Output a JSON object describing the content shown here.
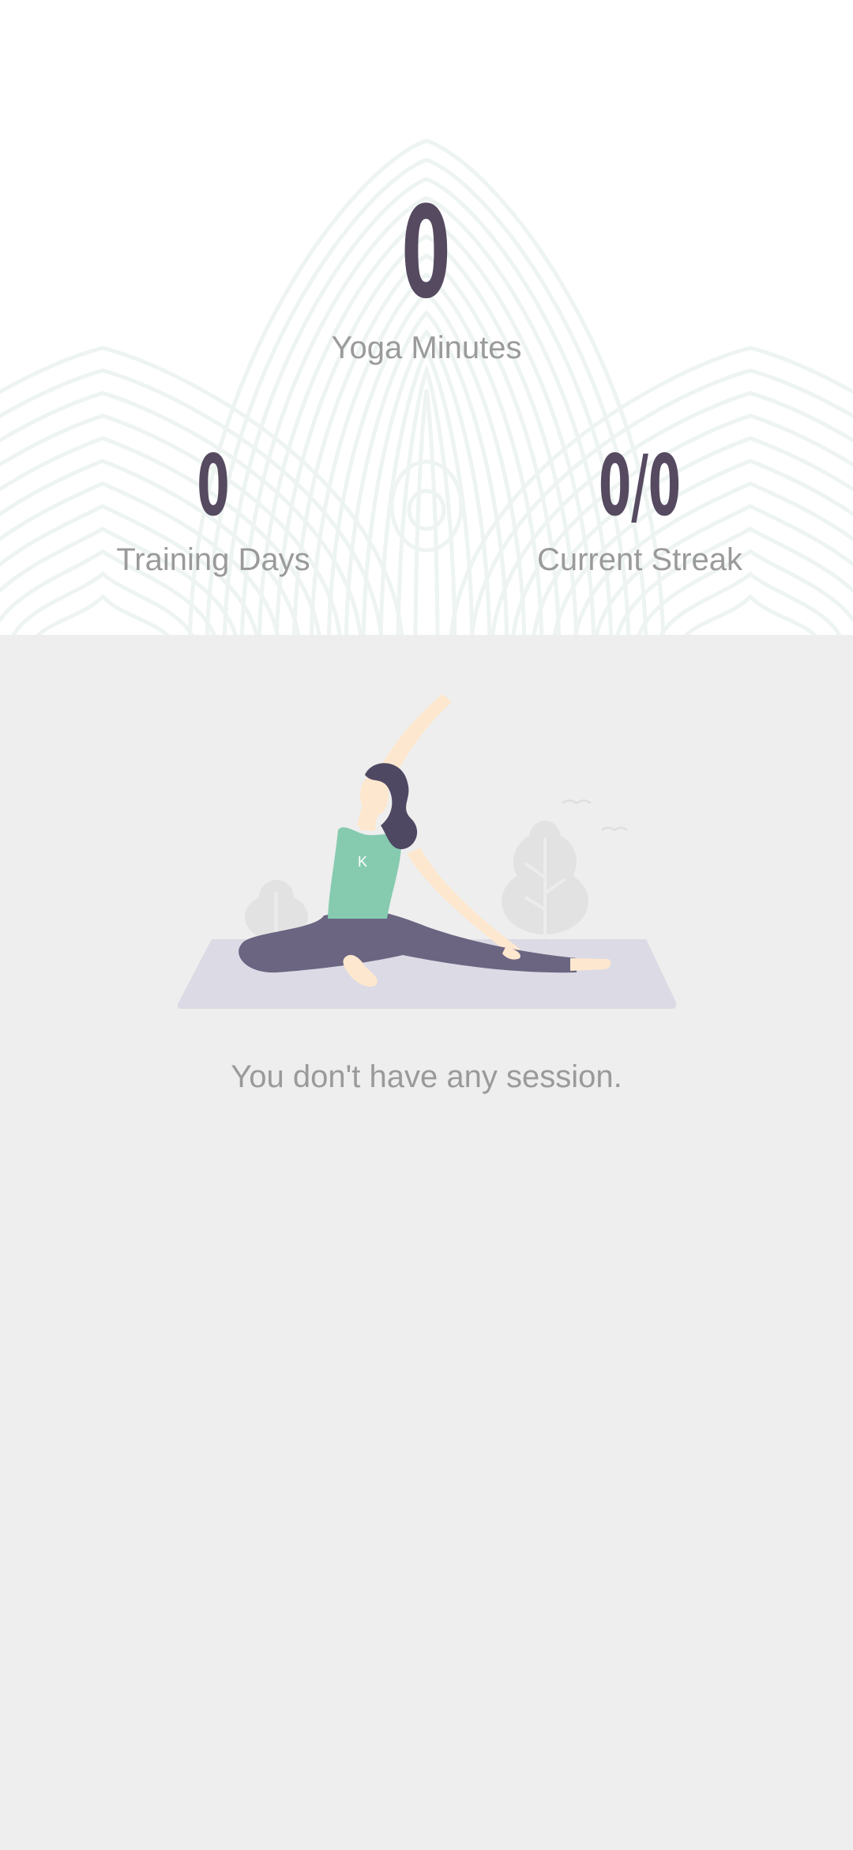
{
  "stats": {
    "yoga_minutes": {
      "value": "0",
      "label": "Yoga Minutes"
    },
    "training_days": {
      "value": "0",
      "label": "Training Days"
    },
    "current_streak": {
      "value": "0/0",
      "label": "Current Streak"
    }
  },
  "empty_state": {
    "message": "You don't have any session."
  },
  "colors": {
    "stats_background": "#ffffff",
    "page_background": "#eeeeee",
    "value_text": "#554a60",
    "label_text": "#9a9a9a",
    "pattern_line": "#edf4f1",
    "shirt": "#86cbb0",
    "pants": "#6b6582",
    "hair": "#4f4862",
    "skin": "#fde8cf",
    "mat": "#dcdae4"
  },
  "illustration": {
    "name": "yoga-woman-illustration",
    "shirt_logo": "K"
  }
}
